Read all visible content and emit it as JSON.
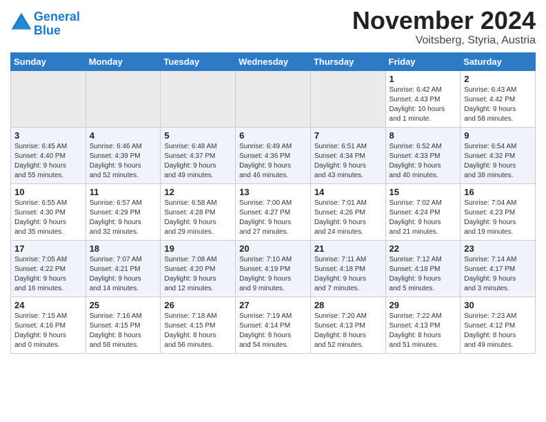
{
  "header": {
    "logo_line1": "General",
    "logo_line2": "Blue",
    "month_title": "November 2024",
    "subtitle": "Voitsberg, Styria, Austria"
  },
  "weekdays": [
    "Sunday",
    "Monday",
    "Tuesday",
    "Wednesday",
    "Thursday",
    "Friday",
    "Saturday"
  ],
  "weeks": [
    [
      {
        "day": "",
        "info": ""
      },
      {
        "day": "",
        "info": ""
      },
      {
        "day": "",
        "info": ""
      },
      {
        "day": "",
        "info": ""
      },
      {
        "day": "",
        "info": ""
      },
      {
        "day": "1",
        "info": "Sunrise: 6:42 AM\nSunset: 4:43 PM\nDaylight: 10 hours\nand 1 minute."
      },
      {
        "day": "2",
        "info": "Sunrise: 6:43 AM\nSunset: 4:42 PM\nDaylight: 9 hours\nand 58 minutes."
      }
    ],
    [
      {
        "day": "3",
        "info": "Sunrise: 6:45 AM\nSunset: 4:40 PM\nDaylight: 9 hours\nand 55 minutes."
      },
      {
        "day": "4",
        "info": "Sunrise: 6:46 AM\nSunset: 4:39 PM\nDaylight: 9 hours\nand 52 minutes."
      },
      {
        "day": "5",
        "info": "Sunrise: 6:48 AM\nSunset: 4:37 PM\nDaylight: 9 hours\nand 49 minutes."
      },
      {
        "day": "6",
        "info": "Sunrise: 6:49 AM\nSunset: 4:36 PM\nDaylight: 9 hours\nand 46 minutes."
      },
      {
        "day": "7",
        "info": "Sunrise: 6:51 AM\nSunset: 4:34 PM\nDaylight: 9 hours\nand 43 minutes."
      },
      {
        "day": "8",
        "info": "Sunrise: 6:52 AM\nSunset: 4:33 PM\nDaylight: 9 hours\nand 40 minutes."
      },
      {
        "day": "9",
        "info": "Sunrise: 6:54 AM\nSunset: 4:32 PM\nDaylight: 9 hours\nand 38 minutes."
      }
    ],
    [
      {
        "day": "10",
        "info": "Sunrise: 6:55 AM\nSunset: 4:30 PM\nDaylight: 9 hours\nand 35 minutes."
      },
      {
        "day": "11",
        "info": "Sunrise: 6:57 AM\nSunset: 4:29 PM\nDaylight: 9 hours\nand 32 minutes."
      },
      {
        "day": "12",
        "info": "Sunrise: 6:58 AM\nSunset: 4:28 PM\nDaylight: 9 hours\nand 29 minutes."
      },
      {
        "day": "13",
        "info": "Sunrise: 7:00 AM\nSunset: 4:27 PM\nDaylight: 9 hours\nand 27 minutes."
      },
      {
        "day": "14",
        "info": "Sunrise: 7:01 AM\nSunset: 4:26 PM\nDaylight: 9 hours\nand 24 minutes."
      },
      {
        "day": "15",
        "info": "Sunrise: 7:02 AM\nSunset: 4:24 PM\nDaylight: 9 hours\nand 21 minutes."
      },
      {
        "day": "16",
        "info": "Sunrise: 7:04 AM\nSunset: 4:23 PM\nDaylight: 9 hours\nand 19 minutes."
      }
    ],
    [
      {
        "day": "17",
        "info": "Sunrise: 7:05 AM\nSunset: 4:22 PM\nDaylight: 9 hours\nand 16 minutes."
      },
      {
        "day": "18",
        "info": "Sunrise: 7:07 AM\nSunset: 4:21 PM\nDaylight: 9 hours\nand 14 minutes."
      },
      {
        "day": "19",
        "info": "Sunrise: 7:08 AM\nSunset: 4:20 PM\nDaylight: 9 hours\nand 12 minutes."
      },
      {
        "day": "20",
        "info": "Sunrise: 7:10 AM\nSunset: 4:19 PM\nDaylight: 9 hours\nand 9 minutes."
      },
      {
        "day": "21",
        "info": "Sunrise: 7:11 AM\nSunset: 4:18 PM\nDaylight: 9 hours\nand 7 minutes."
      },
      {
        "day": "22",
        "info": "Sunrise: 7:12 AM\nSunset: 4:18 PM\nDaylight: 9 hours\nand 5 minutes."
      },
      {
        "day": "23",
        "info": "Sunrise: 7:14 AM\nSunset: 4:17 PM\nDaylight: 9 hours\nand 3 minutes."
      }
    ],
    [
      {
        "day": "24",
        "info": "Sunrise: 7:15 AM\nSunset: 4:16 PM\nDaylight: 9 hours\nand 0 minutes."
      },
      {
        "day": "25",
        "info": "Sunrise: 7:16 AM\nSunset: 4:15 PM\nDaylight: 8 hours\nand 58 minutes."
      },
      {
        "day": "26",
        "info": "Sunrise: 7:18 AM\nSunset: 4:15 PM\nDaylight: 8 hours\nand 56 minutes."
      },
      {
        "day": "27",
        "info": "Sunrise: 7:19 AM\nSunset: 4:14 PM\nDaylight: 8 hours\nand 54 minutes."
      },
      {
        "day": "28",
        "info": "Sunrise: 7:20 AM\nSunset: 4:13 PM\nDaylight: 8 hours\nand 52 minutes."
      },
      {
        "day": "29",
        "info": "Sunrise: 7:22 AM\nSunset: 4:13 PM\nDaylight: 8 hours\nand 51 minutes."
      },
      {
        "day": "30",
        "info": "Sunrise: 7:23 AM\nSunset: 4:12 PM\nDaylight: 8 hours\nand 49 minutes."
      }
    ]
  ]
}
